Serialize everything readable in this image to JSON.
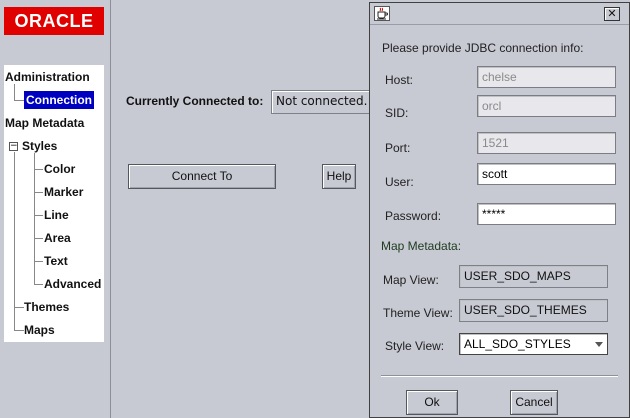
{
  "nav": {
    "logo": "ORACLE",
    "items": {
      "administration": "Administration",
      "connection": "Connection",
      "map_metadata": "Map Metadata",
      "styles": "Styles",
      "color": "Color",
      "marker": "Marker",
      "line": "Line",
      "area": "Area",
      "text": "Text",
      "advanced": "Advanced",
      "themes": "Themes",
      "maps": "Maps"
    },
    "expander_symbol": "−"
  },
  "main": {
    "connected_label": "Currently Connected to:",
    "connected_value": "Not connected.",
    "connect_button": "Connect To",
    "help_button": "Help"
  },
  "dialog": {
    "close_symbol": "✕",
    "prompt": "Please provide JDBC connection info:",
    "host_label": "Host:",
    "host_value": "chelse",
    "sid_label": "SID:",
    "sid_value": "orcl",
    "port_label": "Port:",
    "port_value": "1521",
    "user_label": "User:",
    "user_value": "scott",
    "password_label": "Password:",
    "password_value": "*****",
    "metadata_title": "Map Metadata:",
    "map_view_label": "Map View:",
    "map_view_value": "USER_SDO_MAPS",
    "theme_view_label": "Theme View:",
    "theme_view_value": "USER_SDO_THEMES",
    "style_view_label": "Style View:",
    "style_view_value": "ALL_SDO_STYLES",
    "ok_button": "Ok",
    "cancel_button": "Cancel"
  },
  "colors": {
    "logo_red": "#e00000",
    "selection_blue": "#0000c0",
    "panel_gray": "#c7c9d3"
  }
}
